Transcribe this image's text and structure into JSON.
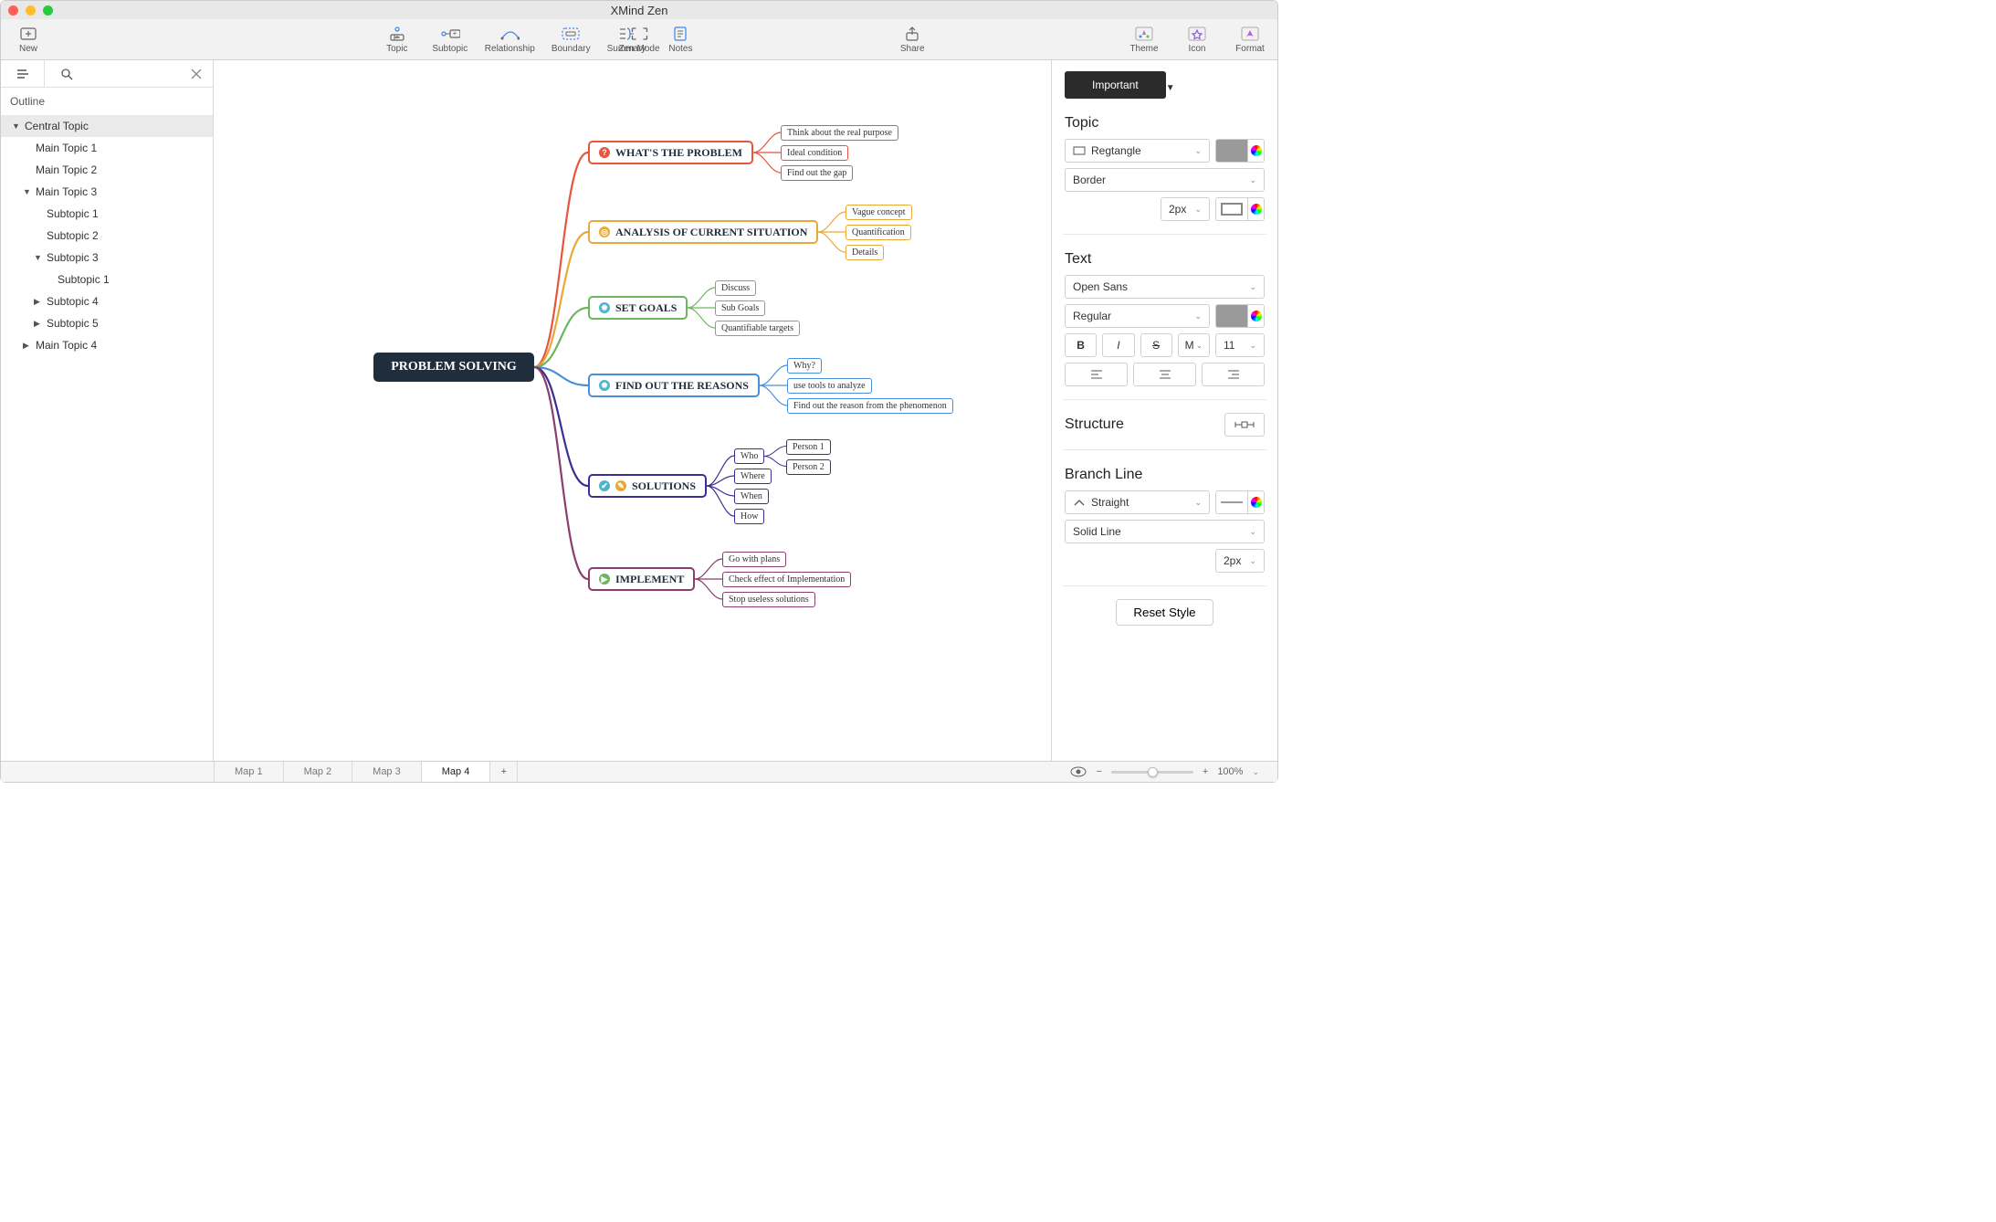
{
  "window": {
    "title": "XMind Zen"
  },
  "toolbar": {
    "new": "New",
    "topic": "Topic",
    "subtopic": "Subtopic",
    "relationship": "Relationship",
    "boundary": "Boundary",
    "summary": "Summary",
    "notes": "Notes",
    "zen": "Zen Mode",
    "share": "Share",
    "theme": "Theme",
    "icon": "Icon",
    "format": "Format"
  },
  "outline": {
    "header": "Outline",
    "items": [
      {
        "label": "Central Topic",
        "indent": 1,
        "arrow": "down",
        "selected": true
      },
      {
        "label": "Main Topic 1",
        "indent": 2,
        "arrow": ""
      },
      {
        "label": "Main Topic 2",
        "indent": 2,
        "arrow": ""
      },
      {
        "label": "Main Topic 3",
        "indent": 2,
        "arrow": "down"
      },
      {
        "label": "Subtopic 1",
        "indent": 3,
        "arrow": ""
      },
      {
        "label": "Subtopic 2",
        "indent": 3,
        "arrow": ""
      },
      {
        "label": "Subtopic 3",
        "indent": 3,
        "arrow": "down"
      },
      {
        "label": "Subtopic 1",
        "indent": 4,
        "arrow": ""
      },
      {
        "label": "Subtopic 4",
        "indent": 3,
        "arrow": "right"
      },
      {
        "label": "Subtopic 5",
        "indent": 3,
        "arrow": "right"
      },
      {
        "label": "Main Topic 4",
        "indent": 2,
        "arrow": "right"
      }
    ]
  },
  "mindmap": {
    "central": "PROBLEM SOLVING",
    "branches": [
      {
        "label": "WHAT'S THE PROBLEM",
        "color": "#e7553c",
        "iconBg": "#e7553c",
        "iconTxt": "?",
        "leaves": [
          "Think about the real purpose",
          "Ideal condition",
          "Find out the gap"
        ]
      },
      {
        "label": "ANALYSIS OF CURRENT SITUATION",
        "color": "#e8a93a",
        "iconBg": "#e8a93a",
        "iconTxt": "◎",
        "leaves": [
          "Vague concept",
          "Quantification",
          "Details"
        ]
      },
      {
        "label": "SET GOALS",
        "color": "#6cb65f",
        "iconBg": "#4fb3c9",
        "iconTxt": "✹",
        "leaves": [
          "Discuss",
          "Sub Goals",
          "Quantifiable targets"
        ]
      },
      {
        "label": "FIND OUT THE REASONS",
        "color": "#4a8fd8",
        "iconBg": "#4fb3c9",
        "iconTxt": "✹",
        "leaves": [
          "Why?",
          "use tools to analyze",
          "Find out the reason from the phenomenon"
        ]
      },
      {
        "label": "SOLUTIONS",
        "color": "#3b2f8f",
        "iconBg": "#4fb3c9",
        "iconTxt": "✔",
        "leaves": [
          "Who",
          "Where",
          "When",
          "How"
        ],
        "subleaves": [
          "Person 1",
          "Person 2"
        ]
      },
      {
        "label": "IMPLEMENT",
        "color": "#8a3d6e",
        "iconBg": "#6cb65f",
        "iconTxt": "▶",
        "leaves": [
          "Go with plans",
          "Check effect of Implementation",
          "Stop useless solutions"
        ]
      }
    ]
  },
  "format": {
    "important": "Important",
    "topicLabel": "Topic",
    "shape": "Regtangle",
    "borderLabel": "Border",
    "borderWidth": "2px",
    "textLabel": "Text",
    "font": "Open Sans",
    "weight": "Regular",
    "size": "11",
    "moreLabel": "M",
    "structureLabel": "Structure",
    "branchLabel": "Branch Line",
    "branchStyle": "Straight",
    "lineStyle": "Solid Line",
    "lineWidth": "2px",
    "reset": "Reset Style",
    "swatchFill": "#9a9a9a",
    "swatchText": "#9a9a9a",
    "swatchLine": "#9a9a9a"
  },
  "tabs": {
    "list": [
      "Map 1",
      "Map 2",
      "Map 3",
      "Map 4"
    ],
    "active": 3
  },
  "zoom": {
    "pct": "100%"
  }
}
